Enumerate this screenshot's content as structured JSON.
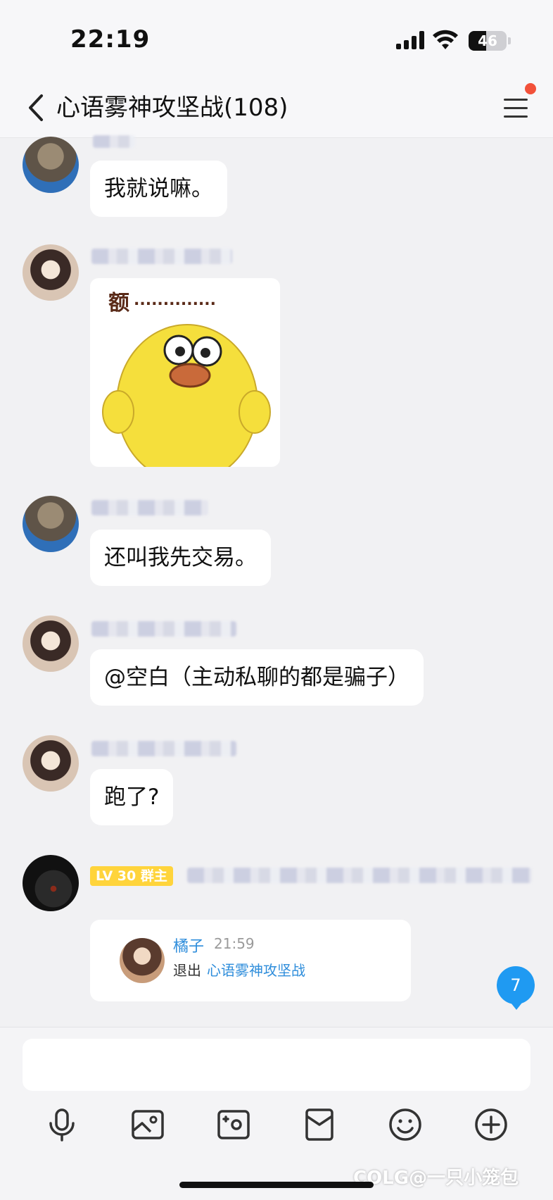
{
  "status_bar": {
    "time": "22:19",
    "battery": "46",
    "battery_level": 0.46
  },
  "header": {
    "title": "心语雾神攻坚战(108)",
    "has_notification_dot": true
  },
  "messages": [
    {
      "type": "text",
      "avatar": "anime-boy-avatar",
      "text": "我就说嘛。"
    },
    {
      "type": "sticker",
      "avatar": "anime-boy-avatar-2",
      "caption": "额"
    },
    {
      "type": "text",
      "avatar": "anime-boy-avatar",
      "text": "还叫我先交易。"
    },
    {
      "type": "text",
      "avatar": "anime-boy-avatar-2",
      "text": "@空白（主动私聊的都是骗子）"
    },
    {
      "type": "text",
      "avatar": "anime-boy-avatar-2",
      "text": "跑了?"
    },
    {
      "type": "system-card",
      "avatar": "dark-photo-avatar",
      "badge": "LV 30 群主",
      "card": {
        "name": "橘子",
        "time": "21:59",
        "action": "退出",
        "group": "心语雾神攻坚战"
      }
    }
  ],
  "unread_count": "7",
  "input": {
    "placeholder": ""
  },
  "toolbar": [
    "microphone-icon",
    "image-icon",
    "camera-icon",
    "red-packet-icon",
    "emoji-icon",
    "plus-icon"
  ],
  "watermark": "COLG@一只小笼包",
  "colors": {
    "background": "#f1f1f3",
    "bubble": "#ffffff",
    "accent_blue": "#1f9af2",
    "link_blue": "#2e8ddb",
    "badge_yellow": "#ffd43b",
    "notification_red": "#f2513a"
  }
}
